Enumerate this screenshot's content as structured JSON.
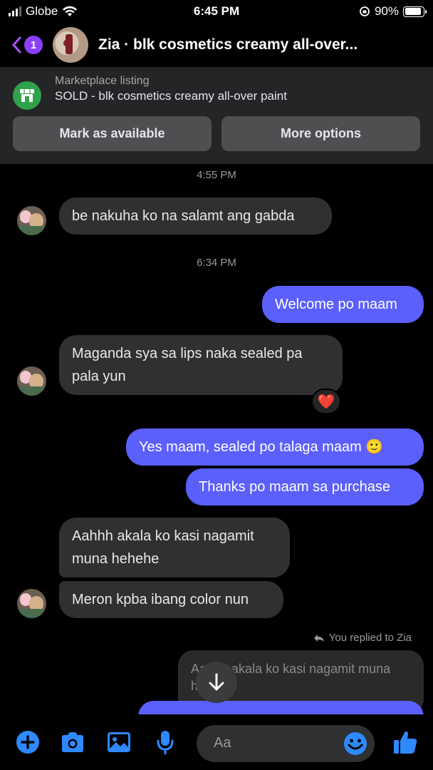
{
  "status_bar": {
    "carrier": "Globe",
    "time": "6:45 PM",
    "battery": "90%",
    "battery_level": 0.9
  },
  "header": {
    "unread_count": "1",
    "title": "Zia · blk cosmetics creamy all-over..."
  },
  "marketplace": {
    "label": "Marketplace listing",
    "listing": "SOLD - blk cosmetics creamy all-over paint",
    "buttons": {
      "mark_available": "Mark as available",
      "more_options": "More options"
    }
  },
  "chat": {
    "timestamps": [
      "4:55 PM",
      "6:34 PM"
    ],
    "messages": [
      {
        "from": "them",
        "text": "be nakuha ko na salamt ang gabda"
      },
      {
        "from": "me",
        "text": "Welcome po maam"
      },
      {
        "from": "them",
        "text": "Maganda sya sa lips naka sealed pa pala yun",
        "reaction": "❤️"
      },
      {
        "from": "me",
        "text": "Yes maam, sealed po talaga maam 🙂"
      },
      {
        "from": "me",
        "text": "Thanks po maam sa purchase"
      },
      {
        "from": "them",
        "text": "Aahhh akala ko kasi nagamit muna hehehe"
      },
      {
        "from": "them",
        "text": "Meron kpba ibang color nun"
      }
    ],
    "reply_context": "You replied to Zia",
    "quoted_text": "Aahhh akala ko kasi nagamit muna hehehe"
  },
  "composer": {
    "placeholder": "Aa"
  },
  "colors": {
    "accent": "#5b5ffc",
    "incoming_bubble": "#303030",
    "badge": "#8a3ffc",
    "marketplace_icon": "#31a24c",
    "icons": "#2e89ff"
  }
}
